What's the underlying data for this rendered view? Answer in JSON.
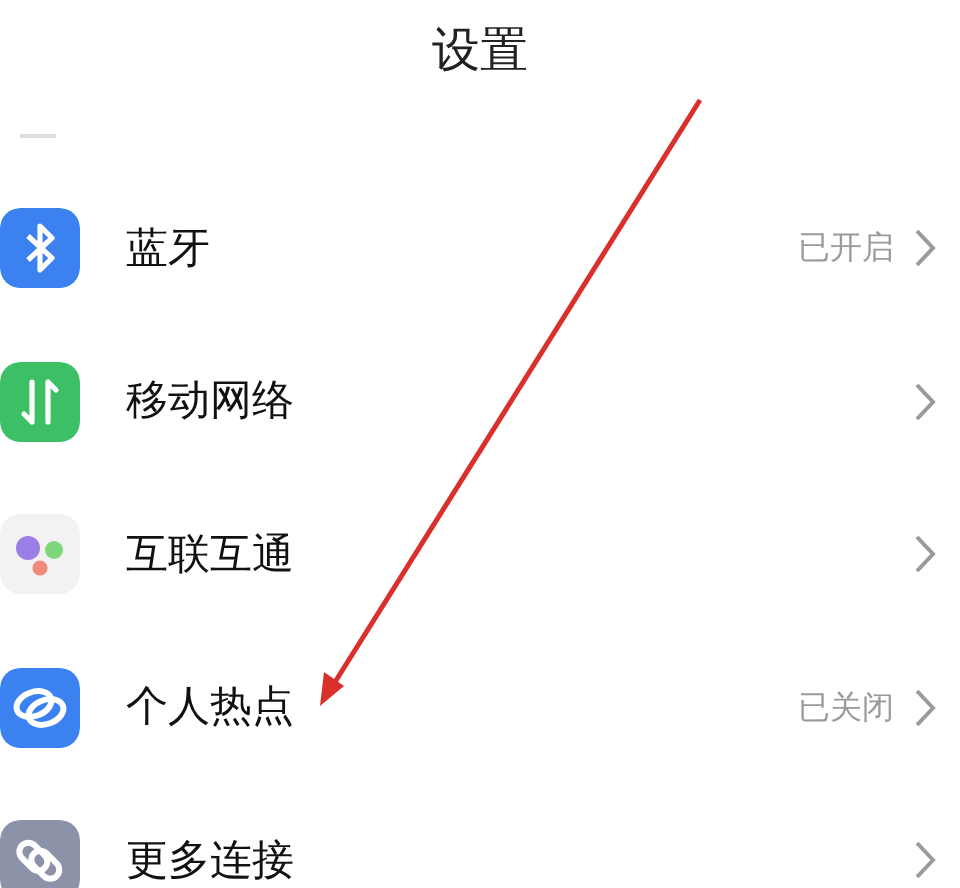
{
  "header": {
    "title": "设置"
  },
  "items": [
    {
      "kind": "bluetooth",
      "label": "蓝牙",
      "value": "已开启",
      "color": "#3b82f0"
    },
    {
      "kind": "mobile-network",
      "label": "移动网络",
      "color": "#3dc065"
    },
    {
      "kind": "interconnect",
      "label": "互联互通",
      "color": "#f2f2f4"
    },
    {
      "kind": "hotspot",
      "label": "个人热点",
      "value": "已关闭",
      "color": "#3b82f0"
    },
    {
      "kind": "more-connections",
      "label": "更多连接",
      "color": "#8c93a8"
    }
  ],
  "annotation": {
    "kind": "arrow"
  }
}
